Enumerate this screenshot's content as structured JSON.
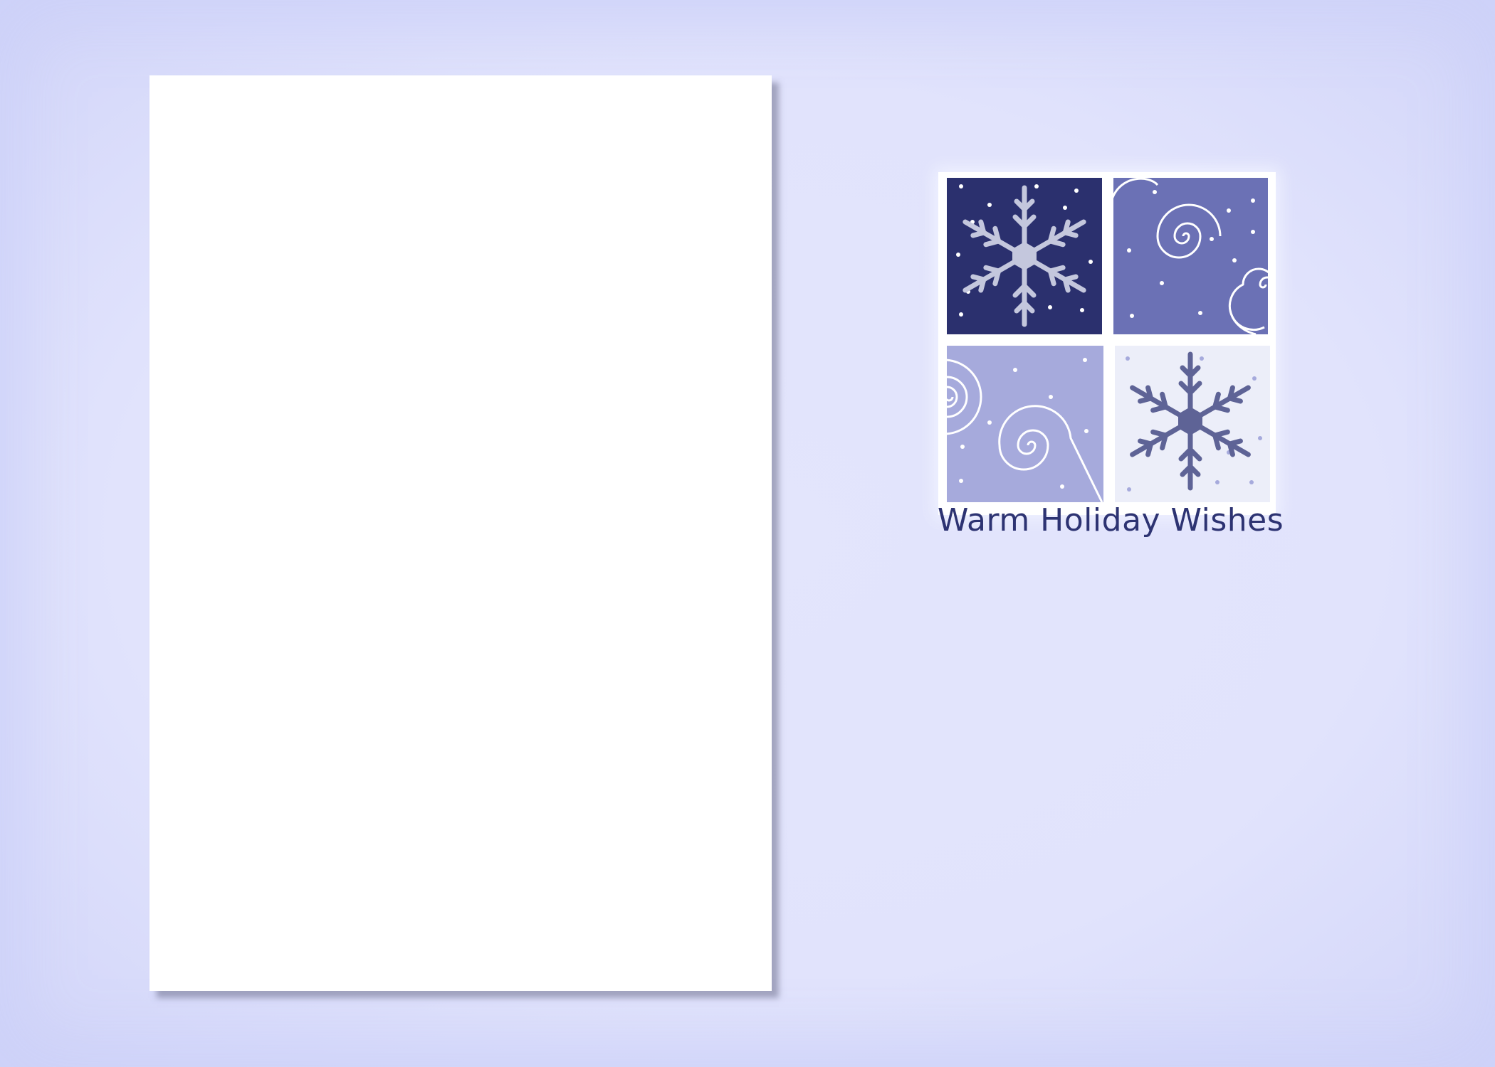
{
  "card": {
    "greeting": "Warm Holiday Wishes"
  },
  "colors": {
    "background": "#e1e3fc",
    "panel": "#ffffff",
    "navy": "#2b306e",
    "periwinkle": "#6b71b5",
    "lavender": "#a6aadc",
    "pale": "#eceef9",
    "snowflake_light": "#c4c7dd",
    "snowflake_dark": "#5e6396",
    "text": "#2d3372"
  },
  "tiles": [
    {
      "name": "navy-snowflake-tile",
      "icon": "snowflake-icon"
    },
    {
      "name": "periwinkle-swirl-tile",
      "icon": "swirl-icon"
    },
    {
      "name": "lavender-swirl-tile",
      "icon": "swirl-icon"
    },
    {
      "name": "pale-snowflake-tile",
      "icon": "snowflake-icon"
    }
  ]
}
